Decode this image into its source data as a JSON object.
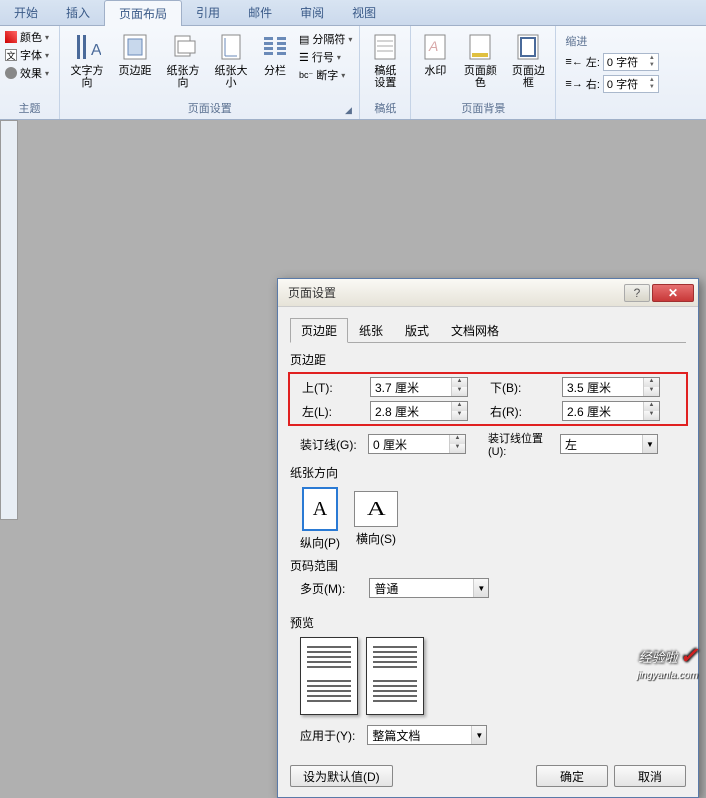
{
  "ribbon_tabs": {
    "start": "开始",
    "insert": "插入",
    "layout": "页面布局",
    "reference": "引用",
    "mail": "邮件",
    "review": "审阅",
    "view": "视图"
  },
  "ribbon_groups": {
    "theme": {
      "title": "主题",
      "color_label": "颜色",
      "font_label": "字体",
      "effect_label": "效果"
    },
    "page_setup": {
      "title": "页面设置",
      "text_direction": "文字方向",
      "margins": "页边距",
      "orientation": "纸张方向",
      "size": "纸张大小",
      "columns": "分栏",
      "separator": "分隔符",
      "line_numbers": "行号",
      "hyphenation": "断字"
    },
    "manuscript": {
      "title": "稿纸",
      "label": "稿纸\n设置"
    },
    "page_bg": {
      "title": "页面背景",
      "watermark": "水印",
      "page_color": "页面颜色",
      "page_border": "页面边框"
    },
    "indent": {
      "title": "缩进",
      "left": "左:",
      "right": "右:",
      "left_val": "0 字符",
      "right_val": "0 字符"
    }
  },
  "dialog": {
    "title": "页面设置",
    "tabs": {
      "margin": "页边距",
      "paper": "纸张",
      "layout": "版式",
      "grid": "文档网格"
    },
    "margins": {
      "section": "页边距",
      "top": "上(T):",
      "top_val": "3.7 厘米",
      "bottom": "下(B):",
      "bottom_val": "3.5 厘米",
      "left": "左(L):",
      "left_val": "2.8 厘米",
      "right": "右(R):",
      "right_val": "2.6 厘米",
      "gutter": "装订线(G):",
      "gutter_val": "0 厘米",
      "gutter_pos": "装订线位置(U):",
      "gutter_pos_val": "左"
    },
    "orientation": {
      "section": "纸张方向",
      "portrait": "纵向(P)",
      "landscape": "横向(S)"
    },
    "pages": {
      "section": "页码范围",
      "multi": "多页(M):",
      "multi_val": "普通"
    },
    "preview": "预览",
    "apply": {
      "label": "应用于(Y):",
      "val": "整篇文档"
    },
    "default_btn": "设为默认值(D)",
    "ok": "确定",
    "cancel": "取消"
  },
  "watermark": {
    "text": "经验啦",
    "url": "jingyanla.com"
  }
}
